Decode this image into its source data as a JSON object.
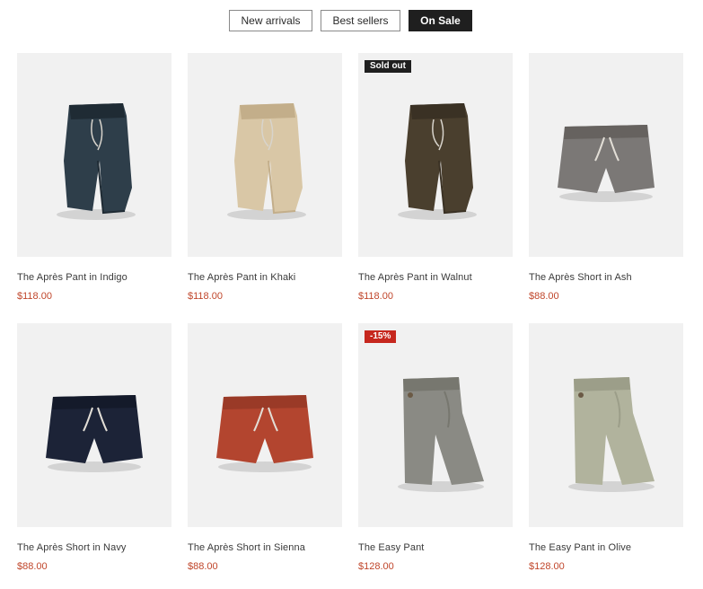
{
  "tabs": [
    {
      "label": "New arrivals",
      "active": false
    },
    {
      "label": "Best sellers",
      "active": false
    },
    {
      "label": "On Sale",
      "active": true
    }
  ],
  "products": [
    {
      "title": "The Après Pant in Indigo",
      "price": "$118.00",
      "badge": "",
      "kind": "pant",
      "color": "#2e3e4a",
      "shade": "#1f2b34"
    },
    {
      "title": "The Après Pant in Khaki",
      "price": "$118.00",
      "badge": "",
      "kind": "pant",
      "color": "#d9c7a6",
      "shade": "#c3ae8a"
    },
    {
      "title": "The Après Pant in Walnut",
      "price": "$118.00",
      "badge": "Sold out",
      "kind": "pant",
      "color": "#4a3f2e",
      "shade": "#3a3124"
    },
    {
      "title": "The Après Short in Ash",
      "price": "$88.00",
      "badge": "",
      "kind": "short",
      "color": "#7b7876",
      "shade": "#66625f"
    },
    {
      "title": "The Après Short in Navy",
      "price": "$88.00",
      "badge": "",
      "kind": "short",
      "color": "#1c2337",
      "shade": "#141a2a"
    },
    {
      "title": "The Après Short in Sienna",
      "price": "$88.00",
      "badge": "",
      "kind": "short",
      "color": "#b3452f",
      "shade": "#9a3a27"
    },
    {
      "title": "The Easy Pant",
      "price": "$128.00",
      "badge": "-15%",
      "kind": "easy",
      "color": "#8a8a84",
      "shade": "#77776f"
    },
    {
      "title": "The Easy Pant in Olive",
      "price": "$128.00",
      "badge": "",
      "kind": "easy",
      "color": "#b1b39d",
      "shade": "#9c9e89"
    }
  ]
}
